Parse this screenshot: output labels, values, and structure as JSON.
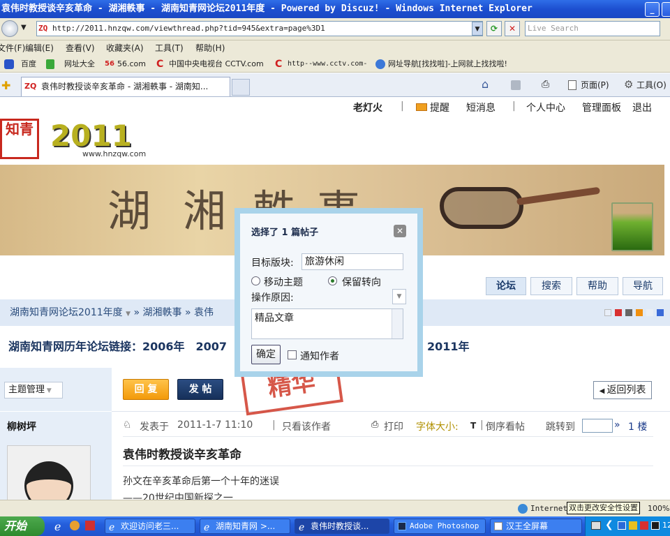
{
  "window": {
    "title": "袁伟时教授谈辛亥革命 - 湖湘軼事 - 湖南知青网论坛2011年度 - Powered by Discuz! - Windows Internet Explorer"
  },
  "address": {
    "url": "http://2011.hnzqw.com/viewthread.php?tid=945&extra=page%3D1",
    "search_placeholder": "Live Search"
  },
  "menu": {
    "items": [
      "文件(F)",
      "编辑(E)",
      "查看(V)",
      "收藏夹(A)",
      "工具(T)",
      "帮助(H)"
    ]
  },
  "favorites": {
    "items": [
      "百度",
      "网址大全",
      "56.com",
      "中国中央电视台 CCTV.com",
      "http--www.cctv.com-",
      "网址导航[找找啦]-上网就上找找啦!"
    ]
  },
  "tab": {
    "label": "袁伟时教授谈辛亥革命 - 湖湘軼事 - 湖南知...",
    "page_label": "页面(P)",
    "tools_label": "工具(O)"
  },
  "userbar": {
    "username": "老灯火",
    "items": [
      "提醒",
      "短消息",
      "个人中心",
      "管理面板",
      "退出"
    ]
  },
  "site": {
    "year": "2011",
    "domain": "www.hnzqw.com",
    "banner_glyphs": [
      "湖",
      "湘",
      "軼",
      "事"
    ]
  },
  "nav": {
    "items": [
      "论坛",
      "搜索",
      "帮助",
      "导航"
    ]
  },
  "breadcrumb": {
    "items": [
      "湖南知青网论坛2011年度",
      "湖湘軼事",
      "袁伟"
    ]
  },
  "links_bar": {
    "text": "湖南知青网历年论坛链接：2006年　2007",
    "suffix": "2011年"
  },
  "thread": {
    "manage_label": "主题管理",
    "reply_label": "回 复",
    "post_label": "发 帖",
    "back_label": "返回列表",
    "author": "柳树坪",
    "posted_prefix": "发表于",
    "posted_time": "2011-1-7 11:10",
    "only_author": "只看该作者",
    "print": "打印",
    "font_size": "字体大小:",
    "font_t": "T",
    "reverse": "倒序看帖",
    "jump": "跳转到",
    "floor": "1 楼",
    "title": "袁伟时教授谈辛亥革命",
    "line1": "孙文在辛亥革命后第一个十年的迷误",
    "line2": "——20世纪中国新探之一",
    "stamp": "精华"
  },
  "dialog": {
    "title": "选择了  1 篇帖子",
    "target_label": "目标版块:",
    "target_value": "旅游休闲",
    "move_label": "移动主题",
    "keep_label": "保留转向",
    "reason_label": "操作原因:",
    "reason_text": "精品文章",
    "confirm_label": "确定",
    "notify_label": "通知作者"
  },
  "status": {
    "zone": "Internet",
    "tooltip": "双击更改安全性设置",
    "zoom": "100%"
  },
  "taskbar": {
    "start": "开始",
    "tasks": [
      "欢迎访问老三...",
      "湖南知青网 >...",
      "袁伟时教授谈...",
      "Adobe Photoshop",
      "汉王全屏幕"
    ],
    "clock": "12"
  },
  "colors": {
    "accent": "#1d4fd0",
    "orange": "#f39a0a",
    "navy": "#16305a",
    "stamp": "#d03a2a"
  }
}
